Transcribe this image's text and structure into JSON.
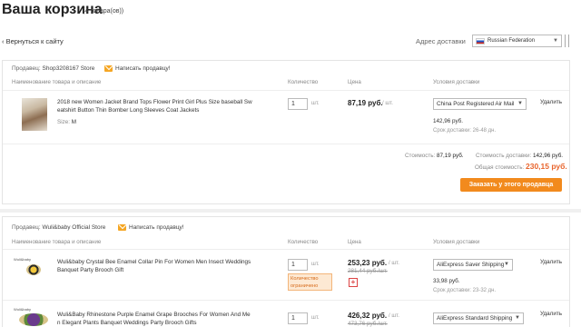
{
  "header": {
    "title": "Ваша корзина",
    "count": "(4 товара(ов))",
    "back": "‹ Вернуться к сайту",
    "ship_label": "Адрес доставки",
    "ship_country": "Russian Federation"
  },
  "columns": {
    "name": "Наименование товара и описание",
    "qty": "Количество",
    "price": "Цена",
    "delivery": "Условия доставки"
  },
  "stores": [
    {
      "seller_label": "Продавец:",
      "seller_name": "Shop3208167 Store",
      "message": "Написать продавцу!",
      "items": [
        {
          "title_l1": "2018 new Women Jacket Brand Tops Flower Print Girl Plus Size baseball Sw",
          "title_l2": "eatshirt Button Thin Bomber Long Sleeves Coat Jackets",
          "size_label": "Size:",
          "size_value": "M",
          "qty": "1",
          "unit": "шт.",
          "price": "87,19 руб.",
          "per": "/ шт.",
          "shipping_method": "China Post Registered Air Mail",
          "shipping_cost": "142,96 руб.",
          "delivery_term": "Срок доставки: 26-48 дн.",
          "delete": "Удалить"
        }
      ],
      "summary": {
        "cost_label": "Стоимость:",
        "cost": "87,19 руб.",
        "ship_cost_label": "Стоимость доставки:",
        "ship_cost": "142,96 руб.",
        "total_label": "Общая стоимость:",
        "total": "230,15 руб.",
        "order_button": "Заказать у этого продавца"
      }
    },
    {
      "seller_label": "Продавец:",
      "seller_name": "Wuli&baby Official Store",
      "message": "Написать продавцу!",
      "items": [
        {
          "title_l1": "Wuli&baby Crystal Bee Enamel Collar Pin For Women Men Insect Weddings",
          "title_l2": "Banquet Party Brooch Gift",
          "qty": "1",
          "unit": "шт.",
          "price": "253,23 руб.",
          "per": "/ шт.",
          "old_price": "281,44 руб./шт.",
          "limit_l1": "Количество",
          "limit_l2": "ограничено",
          "shipping_method": "AliExpress Saver Shipping",
          "shipping_cost": "33,98 руб.",
          "delivery_term": "Срок доставки: 23-32 дн.",
          "delete": "Удалить"
        },
        {
          "title_l1": "Wuli&Baby Rhinestone Purple Enamel Grape Brooches For Women And Me",
          "title_l2": "n Elegant Plants Banquet Weddings Party Brooch Gifts",
          "qty": "1",
          "unit": "шт.",
          "price": "426,32 руб.",
          "per": "/ шт.",
          "old_price": "473,76 руб./шт.",
          "shipping_method": "AliExpress Standard Shipping",
          "delete": "Удалить"
        }
      ]
    }
  ],
  "colors": {
    "accent": "#f28a1d",
    "total": "#e8642c"
  }
}
